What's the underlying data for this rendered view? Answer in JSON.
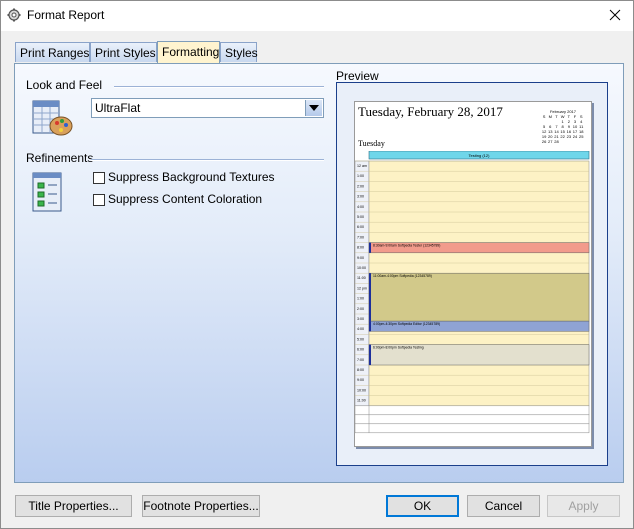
{
  "window": {
    "title": "Format Report"
  },
  "tabs": [
    {
      "label": "Print Ranges"
    },
    {
      "label": "Print Styles"
    },
    {
      "label": "Formatting"
    },
    {
      "label": "Styles"
    }
  ],
  "look_and_feel": {
    "label": "Look and Feel",
    "selected": "UltraFlat"
  },
  "refinements": {
    "label": "Refinements",
    "options": [
      {
        "label": "Suppress Background Textures",
        "checked": false
      },
      {
        "label": "Suppress Content Coloration",
        "checked": false
      }
    ]
  },
  "preview": {
    "label": "Preview",
    "date_title": "Tuesday, February 28, 2017",
    "day_label": "Tuesday",
    "mini_calendar": {
      "title": "February 2017",
      "weekdays": [
        "S",
        "M",
        "T",
        "W",
        "T",
        "F",
        "S"
      ],
      "days": [
        "",
        "",
        "",
        "1",
        "2",
        "3",
        "4",
        "5",
        "6",
        "7",
        "8",
        "9",
        "10",
        "11",
        "12",
        "13",
        "14",
        "15",
        "16",
        "17",
        "18",
        "19",
        "20",
        "21",
        "22",
        "23",
        "24",
        "25",
        "26",
        "27",
        "28",
        "",
        "",
        "",
        ""
      ]
    },
    "all_day_event": "Testing (12)",
    "times": [
      "12 am",
      "1:00",
      "2:00",
      "3:00",
      "4:00",
      "5:00",
      "6:00",
      "7:00",
      "8:00",
      "9:00",
      "10:00",
      "11:00",
      "12 pm",
      "1:00",
      "2:00",
      "3:00",
      "4:00",
      "5:00",
      "6:00",
      "7:00",
      "8:00",
      "9:00",
      "10:00",
      "11:00"
    ],
    "events": [
      {
        "label": "8:30am-9:00am Softpedia Tester (12345789)",
        "color": "#f29b8c",
        "start": 8.0,
        "end": 9.0
      },
      {
        "label": "11:00am-4:00pm Softpedia (12345789)",
        "color": "#d2c98a",
        "start": 11.0,
        "end": 15.7
      },
      {
        "label": "4:00pm-4:30pm Softpedia Editor (12345789)",
        "color": "#8fa3d4",
        "start": 15.7,
        "end": 16.7
      },
      {
        "label": "6:00pm-8:00pm Softpedia Testing",
        "color": "#e3e0ce",
        "start": 18.0,
        "end": 20.0
      }
    ]
  },
  "buttons": {
    "title_properties": "Title Properties...",
    "footnote_properties": "Footnote Properties...",
    "ok": "OK",
    "cancel": "Cancel",
    "apply": "Apply"
  }
}
